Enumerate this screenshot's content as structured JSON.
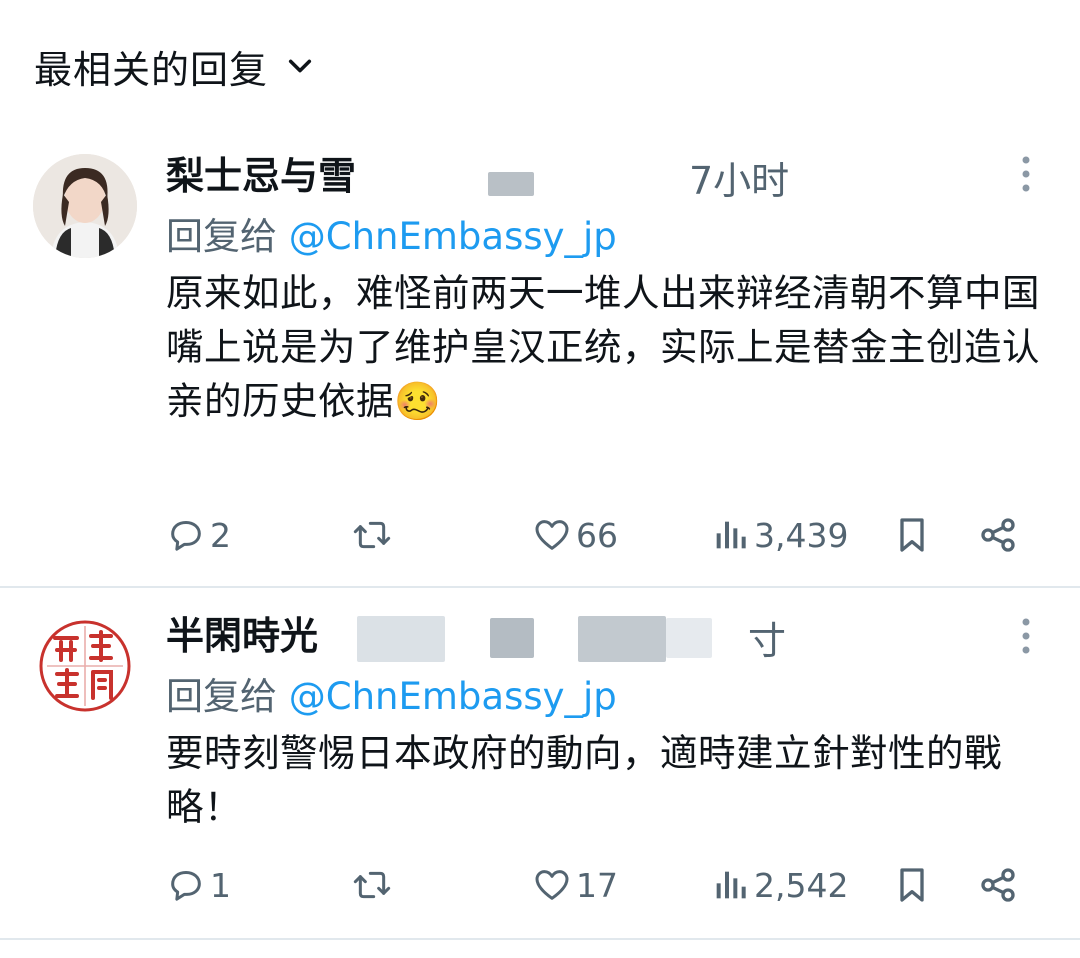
{
  "sort": {
    "label": "最相关的回复"
  },
  "replies": [
    {
      "name": "梨士忌与雪",
      "time": "7小时",
      "reply_to_prefix": "回复给 ",
      "reply_to_handle": "@ChnEmbassy_jp",
      "text": "原来如此，难怪前两天一堆人出来辩经清朝不算中国\n嘴上说是为了维护皇汉正统，实际上是替金主创造认亲的历史依据🥴",
      "replies_count": "2",
      "retweets_count": "",
      "likes_count": "66",
      "views_count": "3,439"
    },
    {
      "name": "半閑時光",
      "time": "寸",
      "reply_to_prefix": "回复给 ",
      "reply_to_handle": "@ChnEmbassy_jp",
      "text": "要時刻警惕日本政府的動向，適時建立針對性的戰略！",
      "replies_count": "1",
      "retweets_count": "",
      "likes_count": "17",
      "views_count": "2,542",
      "avatar_seal_text": "半閑時光"
    }
  ],
  "colors": {
    "accent": "#1d9bf0",
    "muted": "#536471",
    "seal": "#c8322d"
  }
}
